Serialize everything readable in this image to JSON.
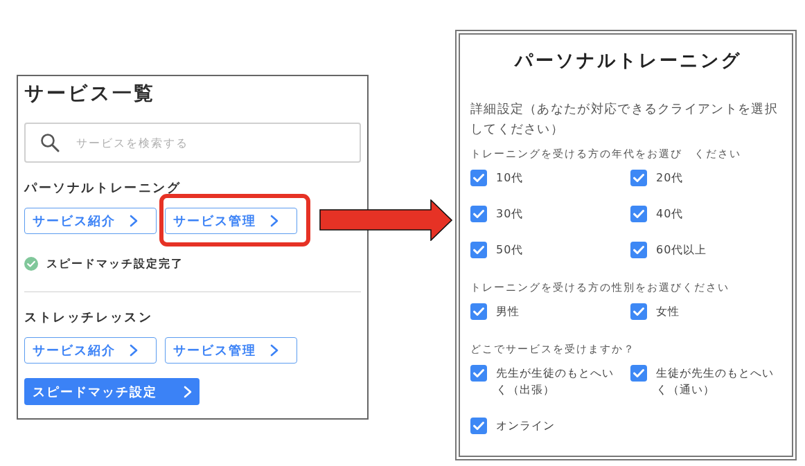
{
  "service_list": {
    "title": "サービス一覧",
    "search": {
      "placeholder": "サービスを検索する"
    },
    "services": [
      {
        "name": "パーソナルトレーニング",
        "buttons": [
          {
            "label": "サービス紹介",
            "kind": "outline",
            "highlighted": false
          },
          {
            "label": "サービス管理",
            "kind": "outline",
            "highlighted": true
          }
        ],
        "status": {
          "text": "スピードマッチ設定完了",
          "done": true
        }
      },
      {
        "name": "ストレッチレッスン",
        "buttons": [
          {
            "label": "サービス紹介",
            "kind": "outline",
            "highlighted": false
          },
          {
            "label": "サービス管理",
            "kind": "outline",
            "highlighted": false
          },
          {
            "label": "スピードマッチ設定",
            "kind": "filled",
            "highlighted": false
          }
        ]
      }
    ]
  },
  "detail_panel": {
    "title": "パーソナルトレーニング",
    "description": "詳細設定（あなたが対応できるクライアントを選択してください）",
    "groups": [
      {
        "heading": "トレーニングを受ける方の年代をお選び　ください",
        "options": [
          {
            "label": "10代",
            "checked": true
          },
          {
            "label": "20代",
            "checked": true
          },
          {
            "label": "30代",
            "checked": true
          },
          {
            "label": "40代",
            "checked": true
          },
          {
            "label": "50代",
            "checked": true
          },
          {
            "label": "60代以上",
            "checked": true
          }
        ]
      },
      {
        "heading": "トレーニングを受ける方の性別をお選びください",
        "options": [
          {
            "label": "男性",
            "checked": true
          },
          {
            "label": "女性",
            "checked": true
          }
        ]
      },
      {
        "heading": "どこでサービスを受けますか？",
        "options": [
          {
            "label": "先生が生徒のもとへいく（出張）",
            "checked": true
          },
          {
            "label": "生徒が先生のもとへいく（通い）",
            "checked": true
          },
          {
            "label": "オンライン",
            "checked": true
          }
        ]
      }
    ]
  }
}
